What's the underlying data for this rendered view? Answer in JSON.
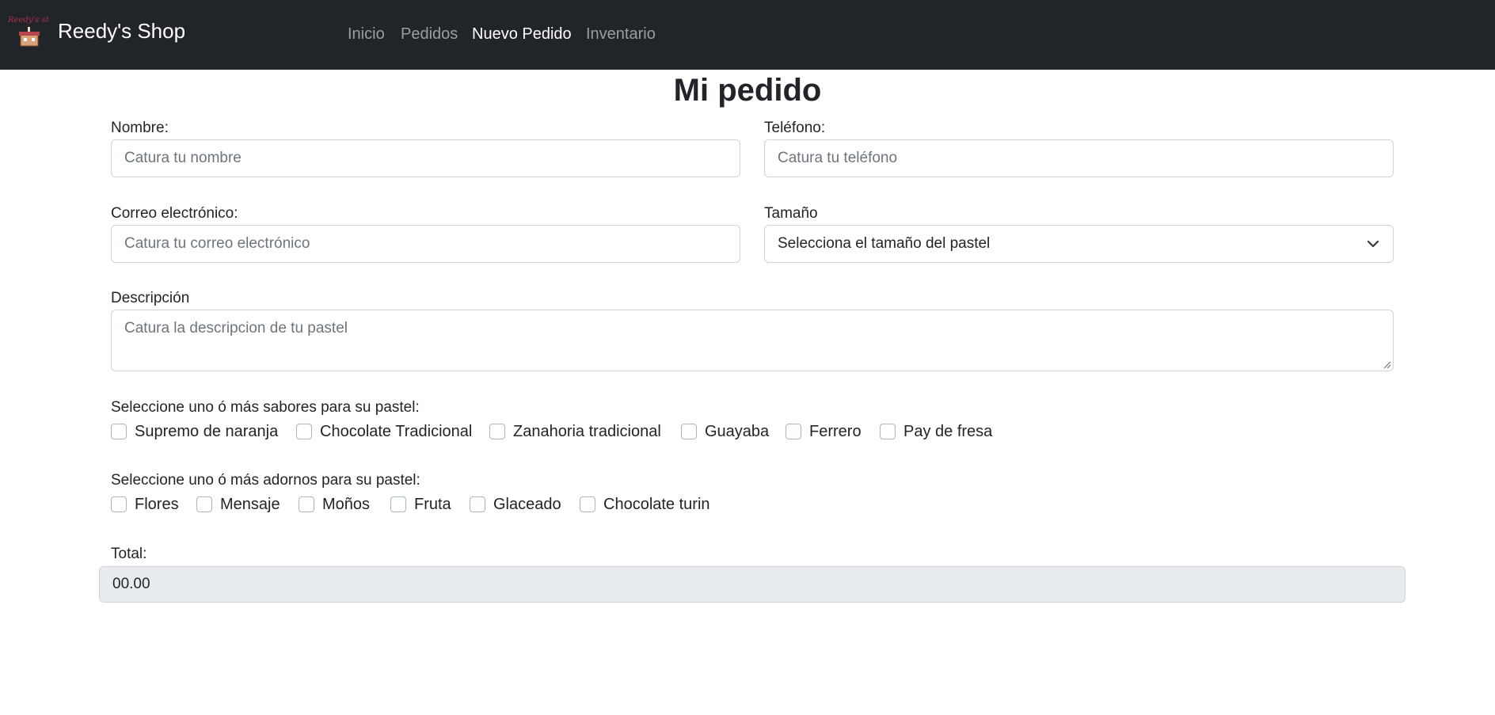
{
  "navbar": {
    "brand": "Reedy's Shop",
    "logo_icon": "cake-shop-logo-icon",
    "links": [
      {
        "label": "Inicio",
        "active": false
      },
      {
        "label": "Pedidos",
        "active": false
      },
      {
        "label": "Nuevo Pedido",
        "active": true
      },
      {
        "label": "Inventario",
        "active": false
      }
    ]
  },
  "page": {
    "title": "Mi pedido"
  },
  "form": {
    "nombre": {
      "label": "Nombre:",
      "placeholder": "Catura tu nombre",
      "value": ""
    },
    "telefono": {
      "label": "Teléfono:",
      "placeholder": "Catura tu teléfono",
      "value": ""
    },
    "correo": {
      "label": "Correo electrónico:",
      "placeholder": "Catura tu correo electrónico",
      "value": ""
    },
    "tamano": {
      "label": "Tamaño",
      "selected": "Selecciona el tamaño del pastel"
    },
    "descripcion": {
      "label": "Descripción",
      "placeholder": "Catura la descripcion de tu pastel",
      "value": ""
    },
    "sabores": {
      "label": "Seleccione uno ó más sabores para su pastel:",
      "options": [
        {
          "label": "Supremo de naranja",
          "checked": false
        },
        {
          "label": "Chocolate Tradicional",
          "checked": false
        },
        {
          "label": "Zanahoria tradicional",
          "checked": false
        },
        {
          "label": "Guayaba",
          "checked": false
        },
        {
          "label": "Ferrero",
          "checked": false
        },
        {
          "label": "Pay de fresa",
          "checked": false
        }
      ]
    },
    "adornos": {
      "label": "Seleccione uno ó más adornos para su pastel:",
      "options": [
        {
          "label": "Flores",
          "checked": false
        },
        {
          "label": "Mensaje",
          "checked": false
        },
        {
          "label": "Moños",
          "checked": false
        },
        {
          "label": "Fruta",
          "checked": false
        },
        {
          "label": "Glaceado",
          "checked": false
        },
        {
          "label": "Chocolate turin",
          "checked": false
        }
      ]
    },
    "total": {
      "label": "Total:",
      "value": "00.00"
    }
  },
  "colors": {
    "navbar_bg": "#212529",
    "field_border": "#ced4da",
    "readonly_bg": "#e9ecef"
  }
}
